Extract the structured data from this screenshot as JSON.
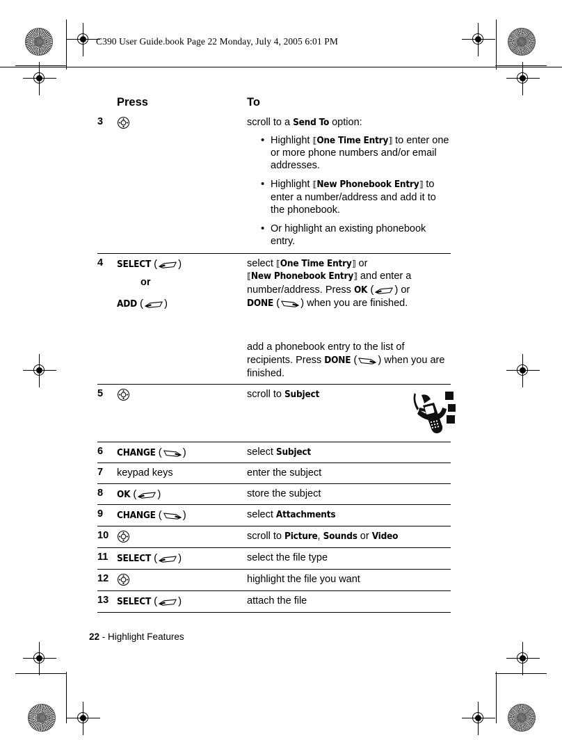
{
  "header": {
    "text": "C390 User Guide.book  Page 22  Monday, July 4, 2005  6:01 PM"
  },
  "table": {
    "columns": {
      "press": "Press",
      "to": "To"
    },
    "rows": [
      {
        "num": "3",
        "press_icon": "nav-key-icon",
        "to_lead": "scroll to a ",
        "to_ui": "Send To",
        "to_tail": " option:",
        "bullets": [
          {
            "pre": "Highlight ",
            "ui": "One Time Entry",
            "post": " to enter one or more phone numbers and/or email addresses.",
            "bracketed": true
          },
          {
            "pre": "Highlight ",
            "ui": "New Phonebook Entry",
            "post": " to enter a number/address and add it to the phonebook.",
            "bracketed": true
          },
          {
            "pre": "Or highlight an existing phonebook entry.",
            "ui": "",
            "post": "",
            "bracketed": false
          }
        ]
      },
      {
        "num": "4",
        "press_label": "SELECT",
        "press_icon": "right-softkey-icon",
        "or_label": "or",
        "press_alt_label": "ADD",
        "press_alt_icon": "right-softkey-icon"
      },
      {
        "num": "5",
        "press_icon": "nav-key-icon",
        "to_lead": "scroll to ",
        "to_ui": "Subject",
        "art": "flip-phone-illustration"
      },
      {
        "num": "6",
        "press_label": "CHANGE",
        "press_icon": "left-softkey-icon",
        "to_lead": "select ",
        "to_ui": "Subject"
      },
      {
        "num": "7",
        "press_plain": "keypad keys",
        "to_lead": "enter the subject"
      },
      {
        "num": "8",
        "press_label": "OK",
        "press_icon": "right-softkey-icon",
        "to_lead": "store the subject"
      },
      {
        "num": "9",
        "press_label": "CHANGE",
        "press_icon": "left-softkey-icon",
        "to_lead": "select ",
        "to_ui": "Attachments"
      },
      {
        "num": "10",
        "press_icon": "nav-key-icon",
        "to_lead": "scroll to ",
        "to_ui_1": "Picture",
        "to_sep_1": ", ",
        "to_ui_2": "Sounds",
        "to_sep_2": " or ",
        "to_ui_3": "Video"
      },
      {
        "num": "11",
        "press_label": "SELECT",
        "press_icon": "right-softkey-icon",
        "to_lead": "select the file type"
      },
      {
        "num": "12",
        "press_icon": "nav-key-icon",
        "to_lead": "highlight the file you want"
      },
      {
        "num": "13",
        "press_label": "SELECT",
        "press_icon": "right-softkey-icon",
        "to_lead": "attach the file"
      }
    ],
    "row4_detail": {
      "select_lead": "select ",
      "select_ui_1": "One Time Entry",
      "select_mid_1": " or ",
      "select_ui_2": "New Phonebook Entry",
      "select_mid_2": " and enter a number/address. Press ",
      "ok_label": "OK",
      "select_mid_3": " or ",
      "done_label": "DONE",
      "select_tail": " when you are finished.",
      "add_lead": "add a phonebook entry to the list of recipients. Press ",
      "add_done_label": "DONE",
      "add_tail": " when you are finished."
    }
  },
  "footer": {
    "page": "22",
    "separator": " - ",
    "section": "Highlight Features"
  }
}
